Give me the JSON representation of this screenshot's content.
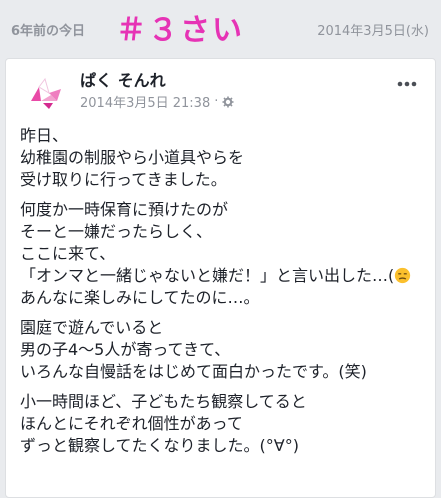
{
  "memory": {
    "years_ago": "6年前の今日",
    "overlay_title": "＃３さい",
    "date": "2014年3月5日(水)"
  },
  "post": {
    "author": "ぱく そんれ",
    "timestamp": "2014年3月5日 21:38",
    "separator": "·",
    "privacy_icon": "gear-icon",
    "menu_icon": "more-icon",
    "paragraphs": [
      [
        "昨日、",
        "幼稚園の制服やら小道具やらを",
        "受け取りに行ってきました。"
      ],
      [
        "何度か一時保育に預けたのが",
        "そーと一嫌だったらしく、",
        "ここに来て、",
        "「オンマと一緒じゃないと嫌だ！」と言い出した…(",
        "あんなに楽しみにしてたのに…。"
      ],
      [
        "園庭で遊んでいると",
        "男の子4〜5人が寄ってきて、",
        "いろんな自慢話をはじめて面白かったです。(笑)"
      ],
      [
        "小一時間ほど、子どもたち観察してると",
        "ほんとにそれぞれ個性があって",
        "ずっと観察してたくなりました。(°∀°)"
      ]
    ],
    "emoji_icon": "unamused-face-emoji"
  },
  "colors": {
    "page_bg": "#e9ebee",
    "overlay_pink": "#e633b5",
    "muted": "#90949c",
    "text": "#1d2129"
  }
}
